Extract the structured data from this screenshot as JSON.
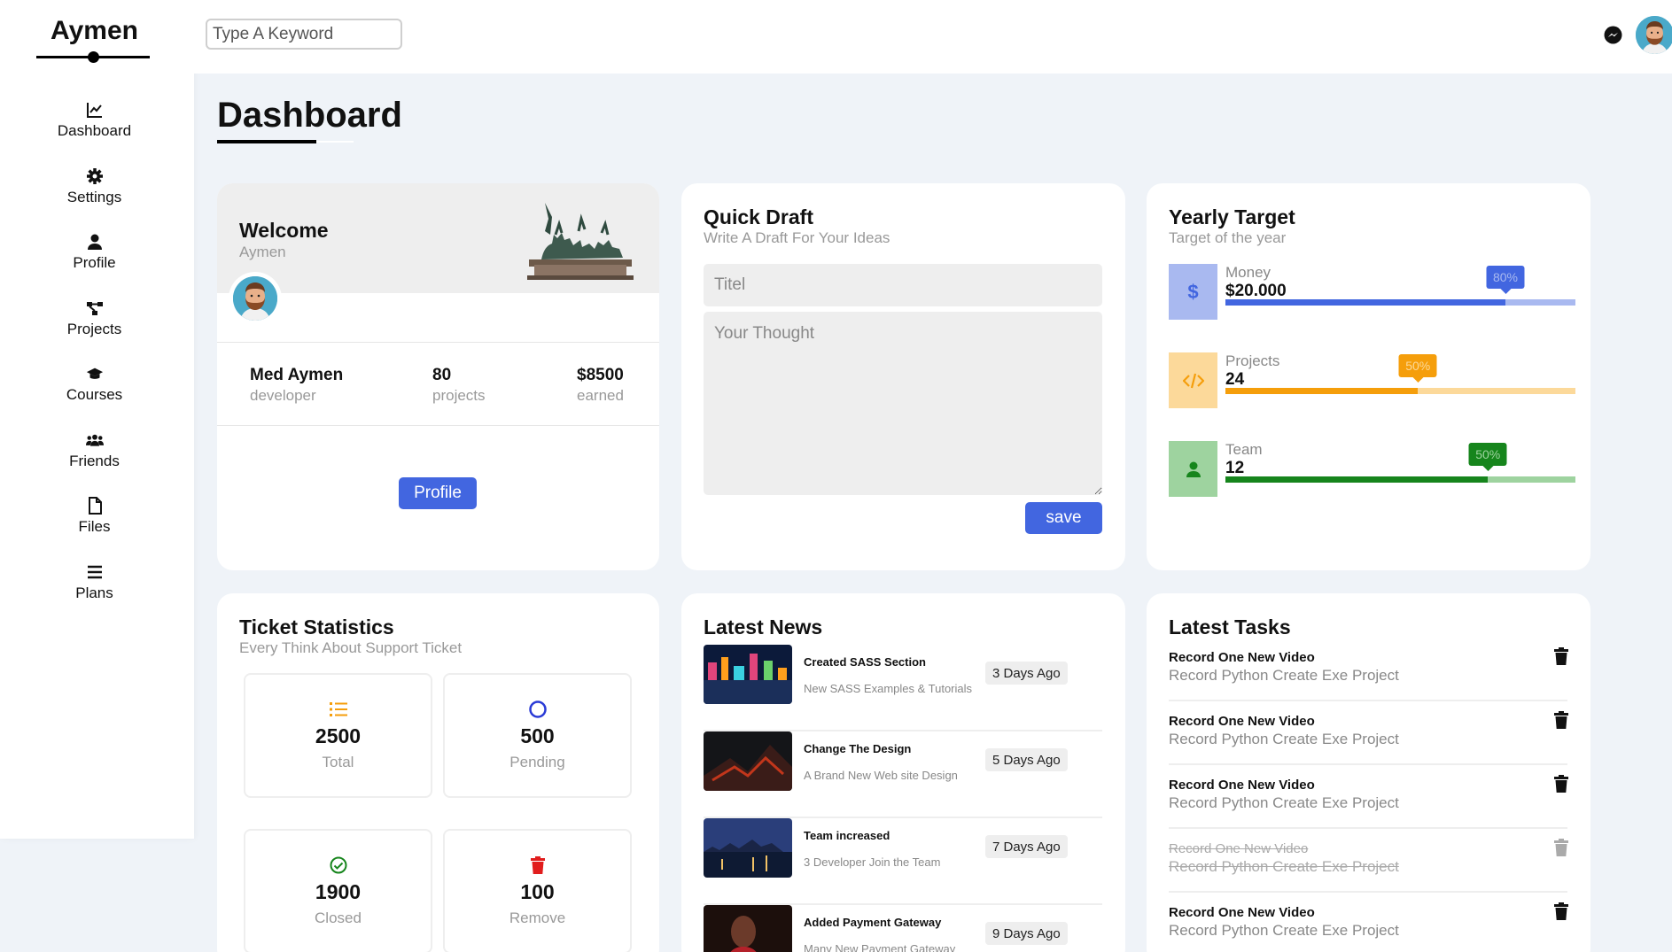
{
  "brand": "Aymen",
  "nav": [
    {
      "label": "Dashboard",
      "icon": "chart-line-icon"
    },
    {
      "label": "Settings",
      "icon": "gear-icon"
    },
    {
      "label": "Profile",
      "icon": "user-icon"
    },
    {
      "label": "Projects",
      "icon": "diagram-project-icon"
    },
    {
      "label": "Courses",
      "icon": "graduation-cap-icon"
    },
    {
      "label": "Friends",
      "icon": "users-icon"
    },
    {
      "label": "Files",
      "icon": "file-icon"
    },
    {
      "label": "Plans",
      "icon": "bars-icon"
    }
  ],
  "header": {
    "search_placeholder": "Type A Keyword",
    "messenger_icon": "messenger-icon",
    "avatar_icon": "avatar-icon"
  },
  "page_title": "Dashboard",
  "welcome": {
    "title": "Welcome",
    "name": "Aymen",
    "stats": [
      {
        "value": "Med Aymen",
        "label": "developer"
      },
      {
        "value": "80",
        "label": "projects"
      },
      {
        "value": "$8500",
        "label": "earned"
      }
    ],
    "button": "Profile"
  },
  "draft": {
    "title": "Quick Draft",
    "subtitle": "Write A Draft For Your Ideas",
    "title_placeholder": "Titel",
    "body_placeholder": "Your Thought",
    "button": "save"
  },
  "target": {
    "title": "Yearly Target",
    "subtitle": "Target of the year",
    "items": [
      {
        "label": "Money",
        "value": "$20.000",
        "percent": 80,
        "badge": "80%",
        "icon": "dollar-icon",
        "color": "#4266e0",
        "light": "#a9b9f0",
        "bg": "#a9b9f0",
        "badge_text_color": "#a9b9f0"
      },
      {
        "label": "Projects",
        "value": "24",
        "percent": 55,
        "badge": "50%",
        "icon": "code-icon",
        "color": "#f59e0b",
        "light": "#fcd99a",
        "bg": "#fcd99a",
        "badge_text_color": "#fcd99a"
      },
      {
        "label": "Team",
        "value": "12",
        "percent": 75,
        "badge": "50%",
        "icon": "user-icon",
        "color": "#16851c",
        "light": "#9ed39f",
        "bg": "#9ed39f",
        "badge_text_color": "#9ed39f"
      }
    ]
  },
  "tickets": {
    "title": "Ticket Statistics",
    "subtitle": "Every Think About Support Ticket",
    "items": [
      {
        "value": "2500",
        "label": "Total",
        "icon": "list-icon",
        "color": "#f59e0b"
      },
      {
        "value": "500",
        "label": "Pending",
        "icon": "spinner-icon",
        "color": "#2a3bd6"
      },
      {
        "value": "1900",
        "label": "Closed",
        "icon": "check-circle-icon",
        "color": "#16851c"
      },
      {
        "value": "100",
        "label": "Remove",
        "icon": "trash-icon",
        "color": "#e11d1d"
      }
    ]
  },
  "news": {
    "title": "Latest News",
    "items": [
      {
        "title": "Created SASS Section",
        "desc": "New SASS Examples & Tutorials",
        "date": "3 Days Ago"
      },
      {
        "title": "Change The Design",
        "desc": "A Brand New Web site Design",
        "date": "5 Days Ago"
      },
      {
        "title": "Team increased",
        "desc": "3 Developer Join the Team",
        "date": "7 Days Ago"
      },
      {
        "title": "Added Payment Gateway",
        "desc": "Many New Payment Gateway",
        "date": "9 Days Ago"
      }
    ]
  },
  "tasks": {
    "title": "Latest Tasks",
    "items": [
      {
        "title": "Record One New Video",
        "sub": "Record Python Create Exe Project",
        "done": false
      },
      {
        "title": "Record One New Video",
        "sub": "Record Python Create Exe Project",
        "done": false
      },
      {
        "title": "Record One New Video",
        "sub": "Record Python Create Exe Project",
        "done": false
      },
      {
        "title": "Record One New Video",
        "sub": "Record Python Create Exe Project",
        "done": true
      },
      {
        "title": "Record One New Video",
        "sub": "Record Python Create Exe Project",
        "done": false
      }
    ]
  }
}
